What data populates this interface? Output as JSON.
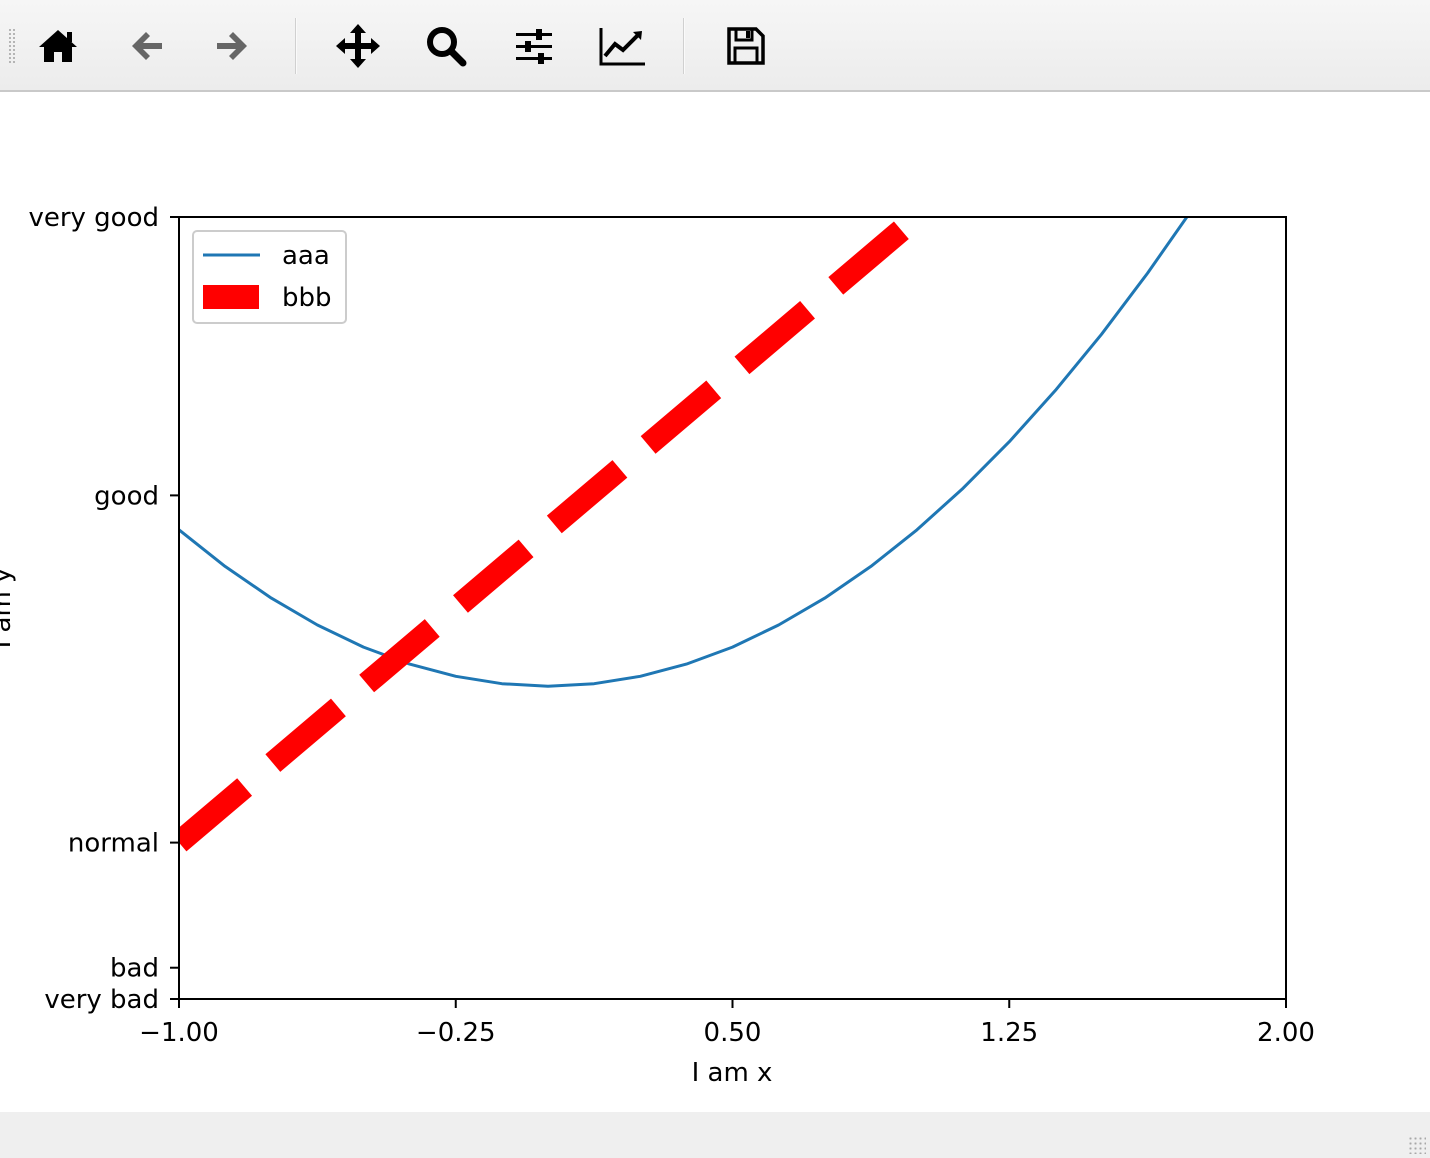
{
  "toolbar": {
    "buttons": [
      {
        "name": "home-button",
        "icon": "home-icon",
        "tooltip": ""
      },
      {
        "name": "back-button",
        "icon": "arrow-left-icon",
        "tooltip": ""
      },
      {
        "name": "forward-button",
        "icon": "arrow-right-icon",
        "tooltip": ""
      },
      {
        "name": "pan-button",
        "icon": "move-arrows-icon",
        "tooltip": ""
      },
      {
        "name": "zoom-button",
        "icon": "magnifier-icon",
        "tooltip": ""
      },
      {
        "name": "configure-subplots-button",
        "icon": "sliders-icon",
        "tooltip": ""
      },
      {
        "name": "edit-axis-button",
        "icon": "line-chart-icon",
        "tooltip": ""
      },
      {
        "name": "save-button",
        "icon": "floppy-disk-icon",
        "tooltip": ""
      }
    ]
  },
  "chart_data": {
    "type": "line",
    "title": "",
    "xlabel": "I am x",
    "ylabel": "I am y",
    "xlim": [
      -1.0,
      2.0
    ],
    "ylim": [
      -2.0,
      3.0
    ],
    "x_ticks": [
      -1.0,
      -0.25,
      0.5,
      1.25,
      2.0
    ],
    "x_tick_labels": [
      "−1.00",
      "−0.25",
      "0.50",
      "1.25",
      "2.00"
    ],
    "y_ticks": [
      -2.0,
      -1.8,
      -1.0,
      1.22,
      3.0
    ],
    "y_tick_labels": [
      "very bad",
      "bad",
      "normal",
      "good",
      "very good"
    ],
    "grid": false,
    "legend_position": "upper-left",
    "series": [
      {
        "name": "aaa",
        "color": "#1f77b4",
        "style": "solid",
        "x": [
          -1.0,
          -0.875,
          -0.75,
          -0.625,
          -0.5,
          -0.375,
          -0.25,
          -0.125,
          0.0,
          0.125,
          0.25,
          0.375,
          0.5,
          0.625,
          0.75,
          0.875,
          1.0,
          1.125,
          1.25,
          1.375,
          1.5,
          1.625,
          1.75
        ],
        "y": [
          1.0,
          0.766,
          0.563,
          0.391,
          0.25,
          0.141,
          0.063,
          0.016,
          0.0,
          0.016,
          0.063,
          0.141,
          0.25,
          0.391,
          0.563,
          0.766,
          1.0,
          1.266,
          1.563,
          1.891,
          2.25,
          2.641,
          3.063
        ]
      },
      {
        "name": "bbb",
        "color": "#ff0000",
        "style": "dashed",
        "x": [
          -1.0,
          1.0
        ],
        "y": [
          -1.0,
          3.0
        ]
      }
    ]
  }
}
